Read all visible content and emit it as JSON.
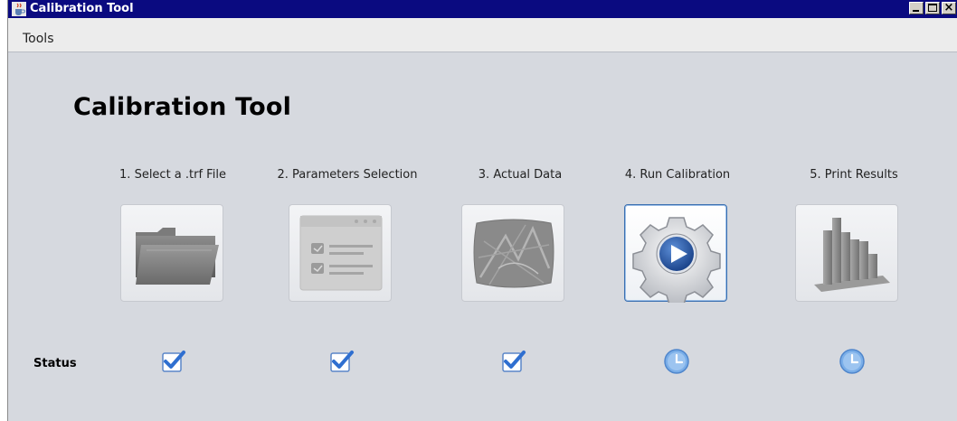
{
  "window": {
    "title": "Calibration Tool",
    "buttons": [
      "minimize",
      "maximize",
      "close"
    ]
  },
  "menu": {
    "items": [
      {
        "label": "Tools"
      }
    ]
  },
  "main": {
    "title": "Calibration Tool",
    "status_label": "Status",
    "steps": [
      {
        "label": "1. Select a .trf File",
        "icon": "folder-icon",
        "state": "disabled",
        "status": "checked"
      },
      {
        "label": "2. Parameters Selection",
        "icon": "form-list-icon",
        "state": "disabled",
        "status": "checked"
      },
      {
        "label": "3. Actual Data",
        "icon": "map-icon",
        "state": "disabled",
        "status": "checked"
      },
      {
        "label": "4. Run Calibration",
        "icon": "gear-play-icon",
        "state": "active",
        "status": "pending"
      },
      {
        "label": "5. Print Results",
        "icon": "bar-chart-icon",
        "state": "disabled",
        "status": "pending"
      }
    ]
  },
  "colors": {
    "titlebar": "#0a0a80",
    "content_bg": "#d6d9df",
    "accent_blue": "#2f6fd0",
    "clock_blue": "#7aaee8"
  }
}
